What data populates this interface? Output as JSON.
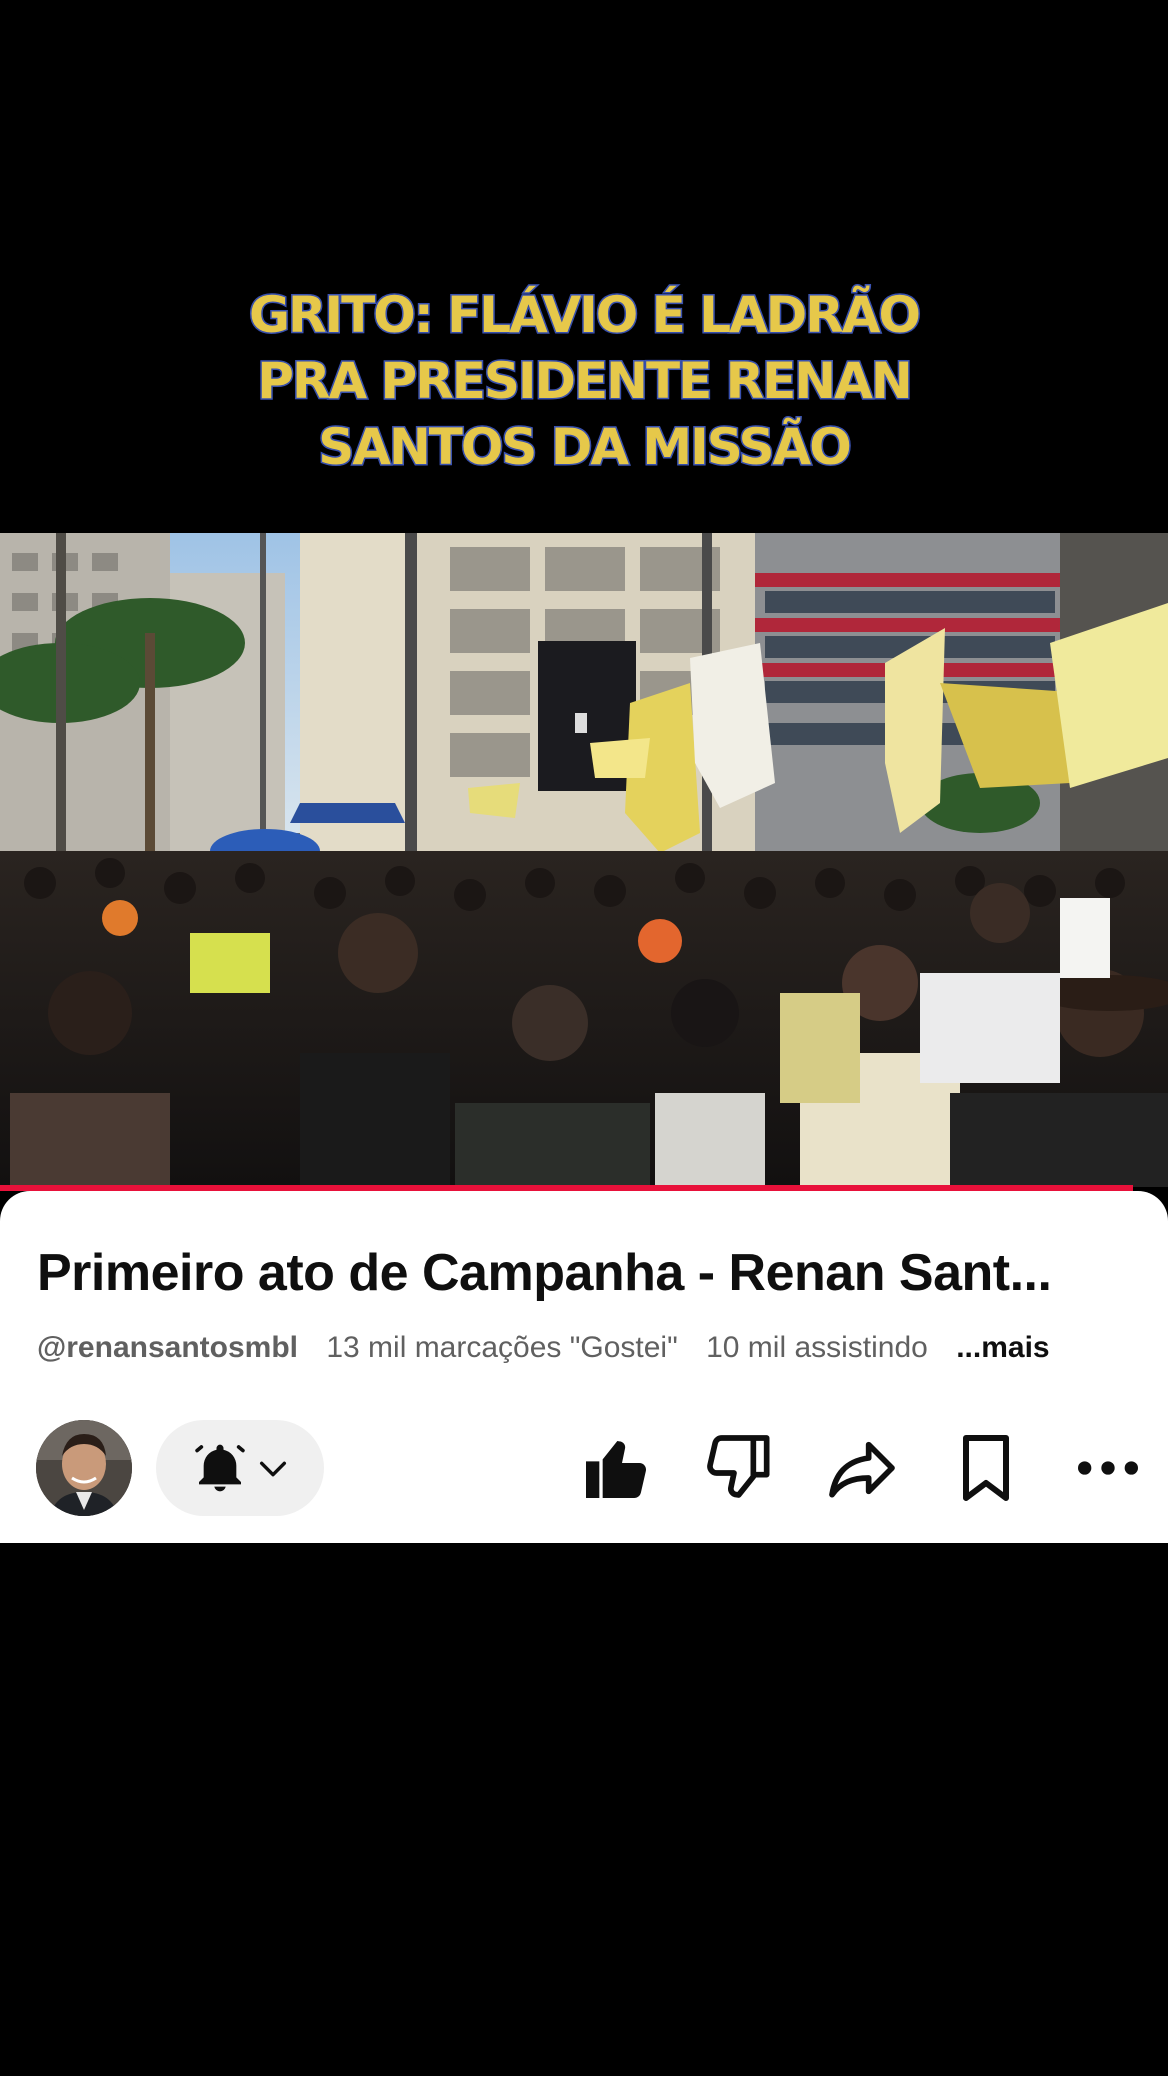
{
  "overlay": {
    "caption_lines": [
      "GRITO: FLÁVIO É LADRÃO",
      "PRA PRESIDENTE RENAN",
      "SANTOS DA MISSÃO"
    ]
  },
  "video": {
    "scene": "crowd-rally-photo",
    "progress_fraction": 0.97,
    "progress_color": "#e8113a"
  },
  "info": {
    "title": "Primeiro ato de Campanha - Renan Sant...",
    "channel": "@renansantosmbl",
    "likes": "13 mil marcações \"Gostei\"",
    "viewers": "10 mil assistindo",
    "more": "...mais"
  },
  "actions": {
    "avatar": "channel-avatar",
    "subscribe_icons": [
      "bell-filled-icon",
      "chevron-down-icon"
    ],
    "buttons": [
      "like-icon",
      "dislike-icon",
      "share-icon",
      "save-icon",
      "more-icon"
    ]
  }
}
